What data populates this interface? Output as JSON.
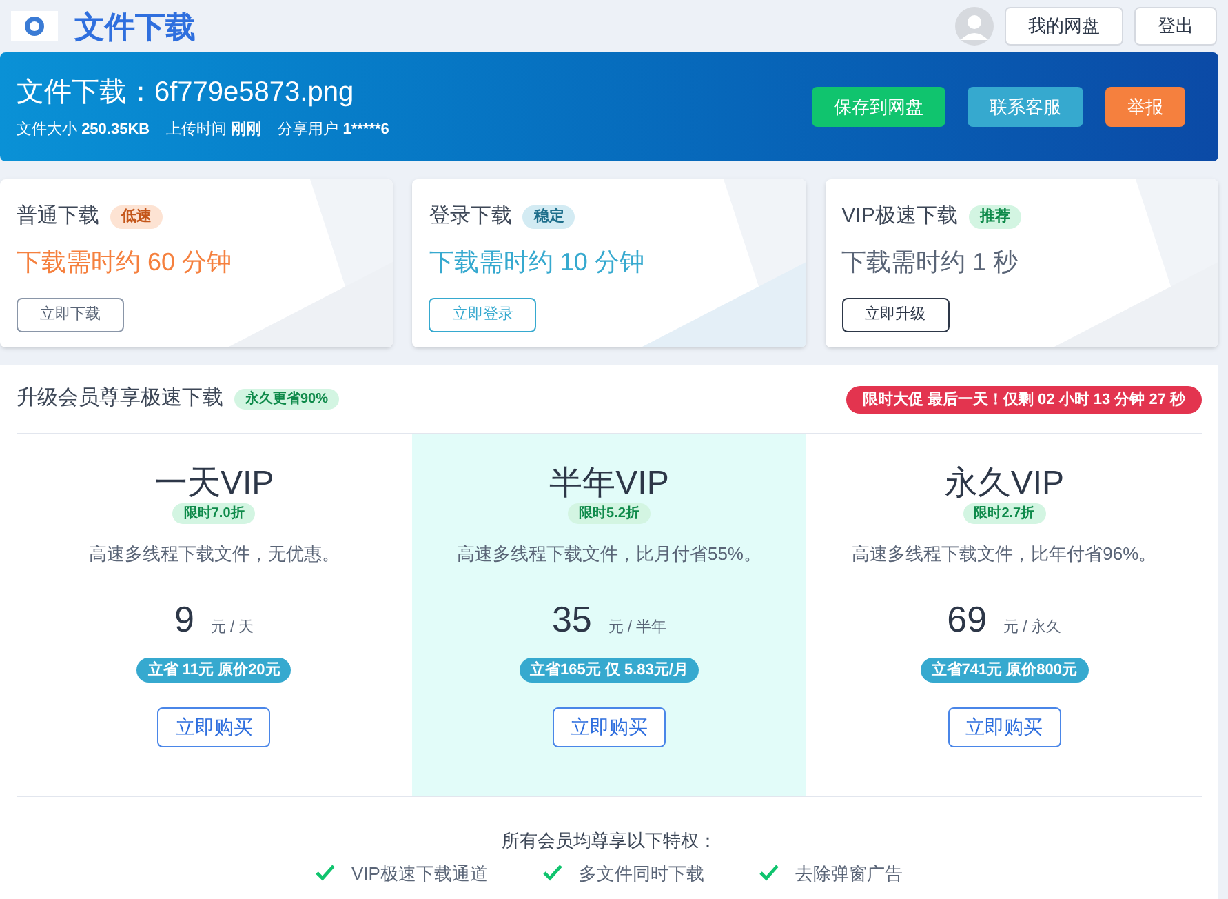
{
  "header": {
    "title": "文件下载",
    "buttons": [
      "我的网盘",
      "登出"
    ]
  },
  "banner": {
    "title": "文件下载：6f779e5873.png",
    "meta": [
      {
        "label": "文件大小",
        "value": "250.35KB"
      },
      {
        "label": "上传时间",
        "value": "刚刚"
      },
      {
        "label": "分享用户",
        "value": "1*****6"
      }
    ],
    "actions": [
      {
        "label": "保存到网盘",
        "kind": "green"
      },
      {
        "label": "联系客服",
        "kind": "cyan"
      },
      {
        "label": "举报",
        "kind": "orange"
      }
    ]
  },
  "download_options": [
    {
      "title": "普通下载",
      "badge": "低速",
      "time": "下载需时约 60 分钟",
      "button": "立即下载",
      "kind": "orange"
    },
    {
      "title": "登录下载",
      "badge": "稳定",
      "time": "下载需时约 10 分钟",
      "button": "立即登录",
      "kind": "cyan"
    },
    {
      "title": "VIP极速下载",
      "badge": "推荐",
      "time": "下载需时约 1 秒",
      "button": "立即升级",
      "kind": "dark"
    }
  ],
  "upgrade": {
    "title": "升级会员尊享极速下载",
    "badge": "永久更省90%",
    "countdown": "限时大促 最后一天！仅剩 02 小时 13 分钟 27 秒",
    "plans": [
      {
        "name": "一天VIP",
        "discount": "限时7.0折",
        "desc": "高速多线程下载文件，无优惠。",
        "price": "9",
        "unit": "元 / 天",
        "saving": "立省 11元 原价20元",
        "button": "立即购买",
        "selected": false
      },
      {
        "name": "半年VIP",
        "discount": "限时5.2折",
        "desc": "高速多线程下载文件，比月付省55%。",
        "price": "35",
        "unit": "元 / 半年",
        "saving": "立省165元 仅 5.83元/月",
        "button": "立即购买",
        "selected": true
      },
      {
        "name": "永久VIP",
        "discount": "限时2.7折",
        "desc": "高速多线程下载文件，比年付省96%。",
        "price": "69",
        "unit": "元 / 永久",
        "saving": "立省741元 原价800元",
        "button": "立即购买",
        "selected": false
      }
    ],
    "perks_title": "所有会员均尊享以下特权：",
    "perks": [
      "VIP极速下载通道",
      "多文件同时下载",
      "去除弹窗广告"
    ]
  }
}
